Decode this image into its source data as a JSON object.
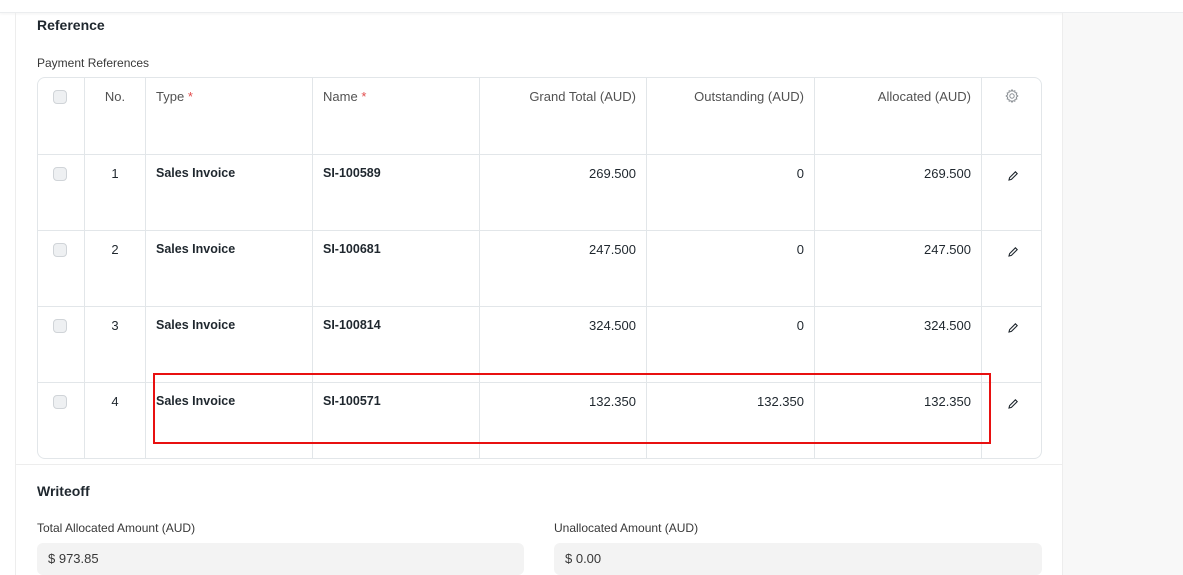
{
  "reference": {
    "title": "Reference",
    "table_label": "Payment References",
    "columns": {
      "no": "No.",
      "type": "Type",
      "name": "Name",
      "grand_total": "Grand Total (AUD)",
      "outstanding": "Outstanding (AUD)",
      "allocated": "Allocated (AUD)",
      "required_mark": "*"
    },
    "rows": [
      {
        "no": "1",
        "type": "Sales Invoice",
        "name": "SI-100589",
        "grand_total": "269.500",
        "outstanding": "0",
        "allocated": "269.500"
      },
      {
        "no": "2",
        "type": "Sales Invoice",
        "name": "SI-100681",
        "grand_total": "247.500",
        "outstanding": "0",
        "allocated": "247.500"
      },
      {
        "no": "3",
        "type": "Sales Invoice",
        "name": "SI-100814",
        "grand_total": "324.500",
        "outstanding": "0",
        "allocated": "324.500"
      },
      {
        "no": "4",
        "type": "Sales Invoice",
        "name": "SI-100571",
        "grand_total": "132.350",
        "outstanding": "132.350",
        "allocated": "132.350"
      }
    ],
    "highlighted_row": "4"
  },
  "writeoff": {
    "title": "Writeoff",
    "total_allocated_label": "Total Allocated Amount (AUD)",
    "total_allocated_value": "$ 973.85",
    "unallocated_label": "Unallocated Amount (AUD)",
    "unallocated_value": "$ 0.00"
  },
  "icons": {
    "settings": "gear-icon",
    "edit": "pencil-icon"
  },
  "colors": {
    "required": "#e24c4c",
    "highlight": "#e81010"
  }
}
